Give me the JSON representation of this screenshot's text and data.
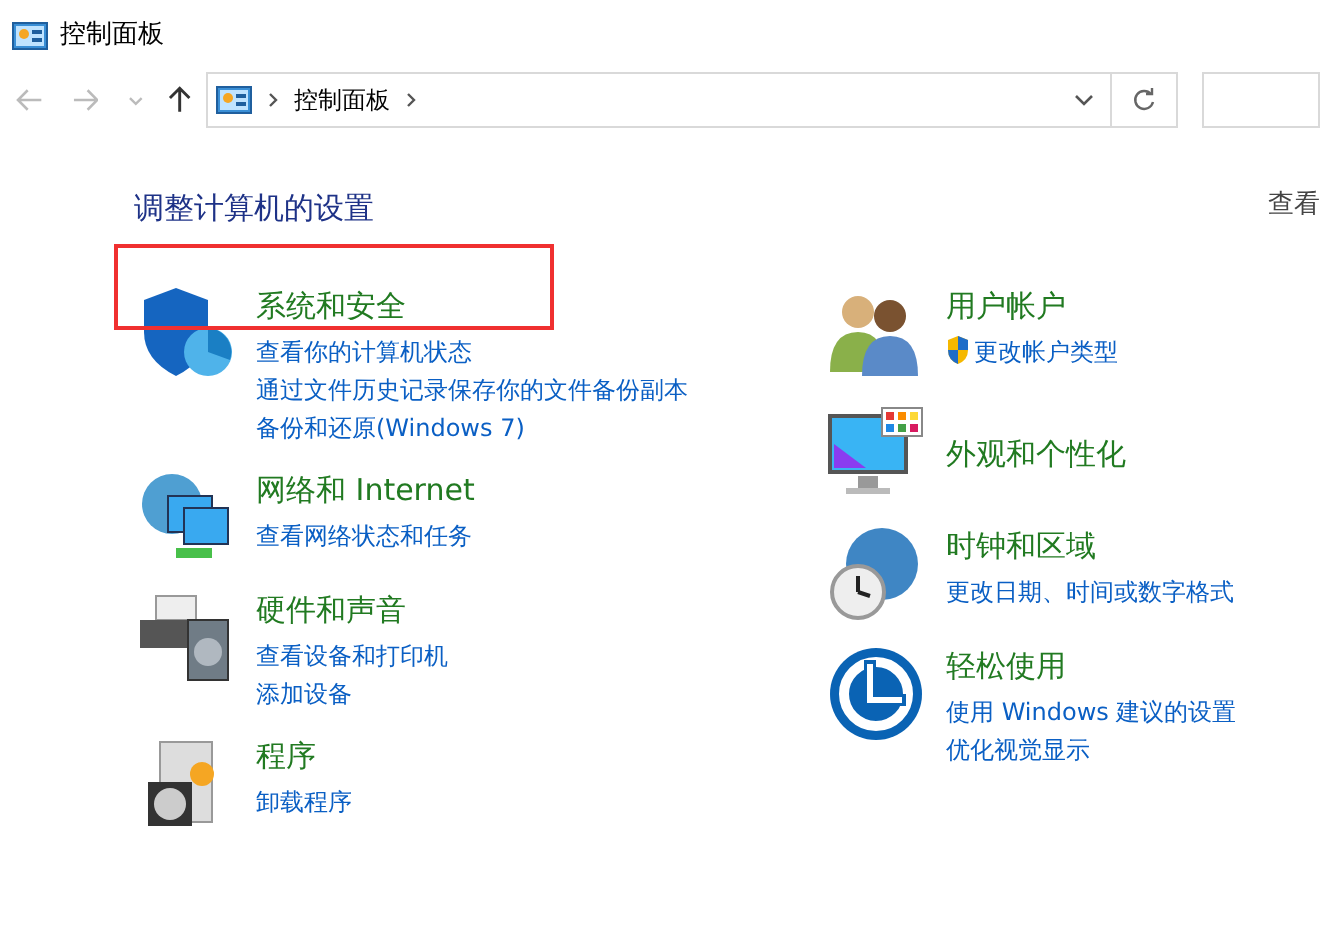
{
  "window": {
    "title": "控制面板"
  },
  "address_bar": {
    "breadcrumbs": [
      "控制面板"
    ]
  },
  "heading": "调整计算机的设置",
  "view_by": "查看",
  "columns": [
    {
      "categories": [
        {
          "title": "系统和安全",
          "highlighted": true,
          "links": [
            {
              "text": "查看你的计算机状态",
              "shield": false
            },
            {
              "text": "通过文件历史记录保存你的文件备份副本",
              "shield": false
            },
            {
              "text": "备份和还原(Windows 7)",
              "shield": false
            }
          ]
        },
        {
          "title": "网络和 Internet",
          "highlighted": false,
          "links": [
            {
              "text": "查看网络状态和任务",
              "shield": false
            }
          ]
        },
        {
          "title": "硬件和声音",
          "highlighted": false,
          "links": [
            {
              "text": "查看设备和打印机",
              "shield": false
            },
            {
              "text": "添加设备",
              "shield": false
            }
          ]
        },
        {
          "title": "程序",
          "highlighted": false,
          "links": [
            {
              "text": "卸载程序",
              "shield": false
            }
          ]
        }
      ]
    },
    {
      "categories": [
        {
          "title": "用户帐户",
          "highlighted": false,
          "links": [
            {
              "text": "更改帐户类型",
              "shield": true
            }
          ]
        },
        {
          "title": "外观和个性化",
          "highlighted": false
        },
        {
          "title": "时钟和区域",
          "highlighted": false,
          "links": [
            {
              "text": "更改日期、时间或数字格式",
              "shield": false
            }
          ]
        },
        {
          "title": "轻松使用",
          "highlighted": false,
          "links": [
            {
              "text": "使用 Windows 建议的设置",
              "shield": false
            },
            {
              "text": "优化视觉显示",
              "shield": false
            }
          ]
        }
      ]
    }
  ]
}
